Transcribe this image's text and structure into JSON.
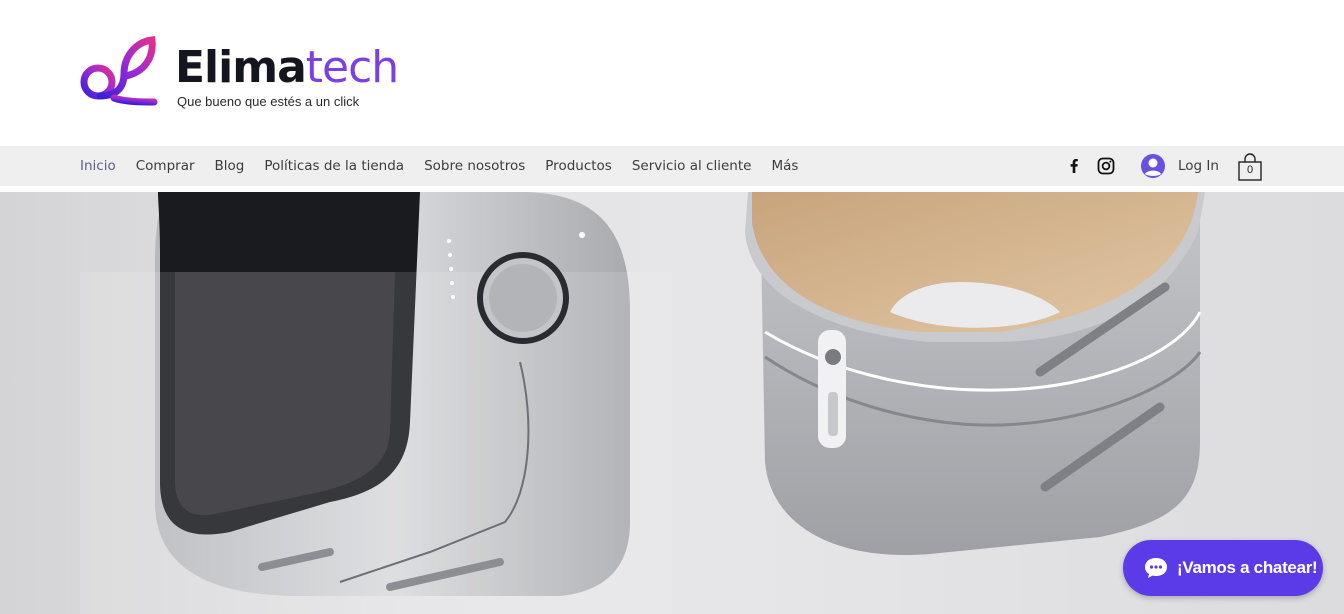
{
  "brand": {
    "name_part1": "Elima",
    "name_part2": "tech",
    "tagline": "Que bueno que estés a un click",
    "colors": {
      "primary": "#7b3fe4",
      "gradient_start": "#3b1fd8",
      "gradient_end": "#e0308e",
      "chat": "#5b3be8"
    }
  },
  "nav": {
    "items": [
      {
        "label": "Inicio",
        "active": true
      },
      {
        "label": "Comprar"
      },
      {
        "label": "Blog"
      },
      {
        "label": "Políticas de la tienda"
      },
      {
        "label": "Sobre nosotros"
      },
      {
        "label": "Productos"
      },
      {
        "label": "Servicio al cliente"
      },
      {
        "label": "Más"
      }
    ],
    "social": [
      "facebook-icon",
      "instagram-icon"
    ],
    "login_label": "Log In",
    "cart_count": "0"
  },
  "hero": {
    "images": [
      "smartwatch-product-image",
      "speaker-product-image"
    ]
  },
  "chat": {
    "label": "¡Vamos a chatear!"
  }
}
